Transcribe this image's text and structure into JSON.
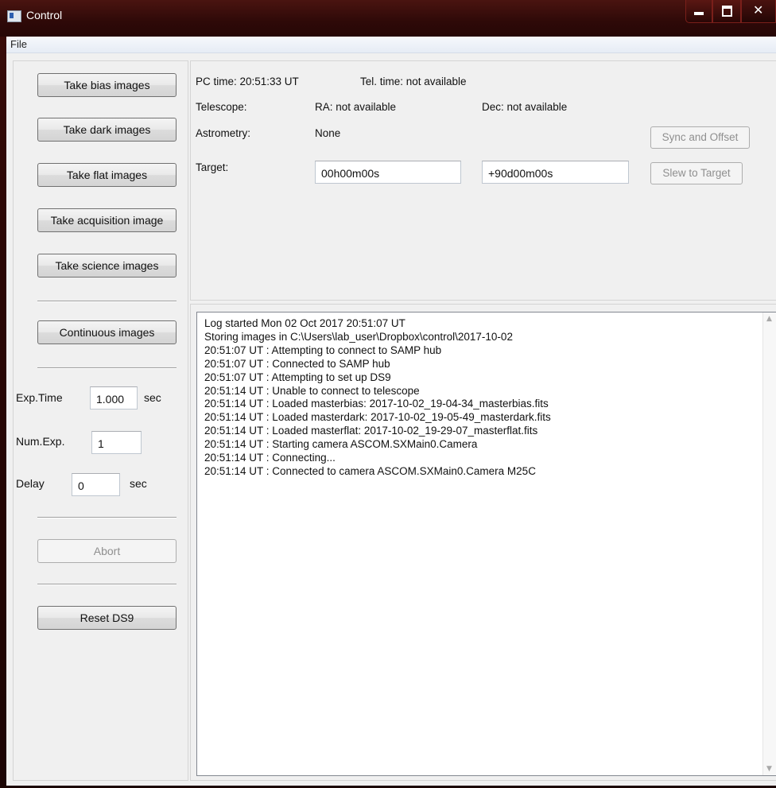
{
  "window": {
    "title": "Control"
  },
  "menu": {
    "file": "File"
  },
  "left": {
    "take_bias": "Take bias images",
    "take_dark": "Take dark images",
    "take_flat": "Take flat images",
    "take_acquisition": "Take acquisition image",
    "take_science": "Take science images",
    "continuous": "Continuous images",
    "exp_time_label": "Exp.Time",
    "exp_time_value": "1.000",
    "exp_time_unit": "sec",
    "num_exp_label": "Num.Exp.",
    "num_exp_value": "1",
    "delay_label": "Delay",
    "delay_value": "0",
    "delay_unit": "sec",
    "abort": "Abort",
    "reset_ds9": "Reset DS9"
  },
  "info": {
    "pc_time": "PC time:  20:51:33 UT",
    "tel_time": "Tel. time:  not available",
    "telescope_label": "Telescope:",
    "ra": "RA:  not available",
    "dec": "Dec:  not available",
    "astrometry_label": "Astrometry:",
    "astrometry_value": "None",
    "target_label": "Target:",
    "target_ra": "00h00m00s",
    "target_dec": "+90d00m00s",
    "sync_offset": "Sync and Offset",
    "slew_target": "Slew to Target"
  },
  "log": {
    "lines": [
      "Log started Mon 02 Oct 2017 20:51:07 UT",
      "Storing images in C:\\Users\\lab_user\\Dropbox\\control\\2017-10-02",
      "20:51:07 UT : Attempting to connect to SAMP hub",
      "20:51:07 UT : Connected to SAMP hub",
      "20:51:07 UT : Attempting to set up DS9",
      "20:51:14 UT : Unable to connect to telescope",
      "20:51:14 UT : Loaded masterbias: 2017-10-02_19-04-34_masterbias.fits",
      "20:51:14 UT : Loaded masterdark: 2017-10-02_19-05-49_masterdark.fits",
      "20:51:14 UT : Loaded masterflat: 2017-10-02_19-29-07_masterflat.fits",
      "20:51:14 UT : Starting camera ASCOM.SXMain0.Camera",
      "20:51:14 UT : Connecting...",
      "20:51:14 UT : Connected to camera ASCOM.SXMain0.Camera M25C"
    ]
  }
}
